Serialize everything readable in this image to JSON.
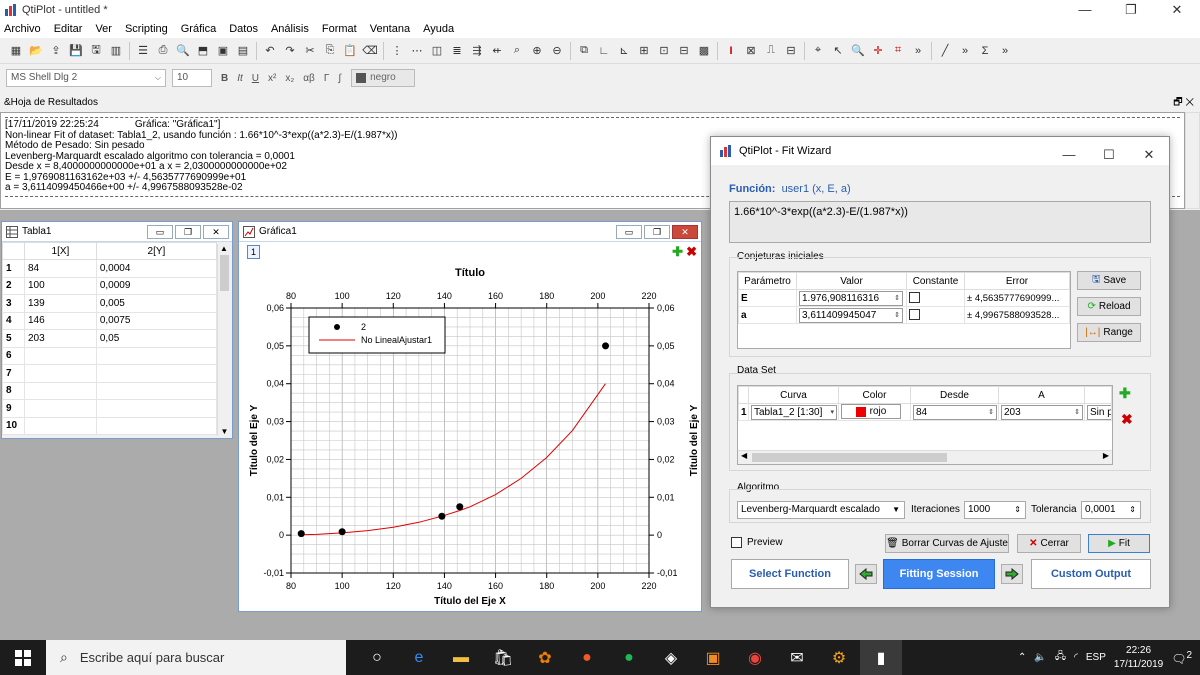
{
  "app": {
    "title": "QtiPlot - untitled *"
  },
  "menu": [
    "Archivo",
    "Editar",
    "Ver",
    "Scripting",
    "Gráfica",
    "Datos",
    "Análisis",
    "Format",
    "Ventana",
    "Ayuda"
  ],
  "format_bar": {
    "font": "MS Shell Dlg 2",
    "size": "10",
    "color": "negro"
  },
  "results": {
    "title": "&Hoja de Resultados",
    "lines": [
      "[17/11/2019 22:25:24             Gráfica: \"Gráfica1\"]",
      "Non-linear Fit of dataset: Tabla1_2, usando función : 1.66*10^-3*exp((a*2.3)-E/(1.987*x))",
      "Método de Pesado: Sin pesado",
      "Levenberg-Marquardt escalado algoritmo con tolerancia = 0,0001",
      "Desde x = 8,4000000000000e+01 a x = 2,0300000000000e+02",
      "E = 1,9769081163162e+03 +/- 4,5635777690999e+01",
      "a = 3,6114099450466e+00 +/- 4,9967588093528e-02"
    ]
  },
  "tabla": {
    "title": "Tabla1",
    "headers": [
      "1[X]",
      "2[Y]"
    ],
    "rows": [
      [
        "1",
        "84",
        "0,0004"
      ],
      [
        "2",
        "100",
        "0,0009"
      ],
      [
        "3",
        "139",
        "0,005"
      ],
      [
        "4",
        "146",
        "0,0075"
      ],
      [
        "5",
        "203",
        "0,05"
      ],
      [
        "6",
        "",
        ""
      ],
      [
        "7",
        "",
        ""
      ],
      [
        "8",
        "",
        ""
      ],
      [
        "9",
        "",
        ""
      ],
      [
        "10",
        "",
        ""
      ]
    ]
  },
  "grafica": {
    "title": "Gráfica1",
    "layer": "1"
  },
  "chart_data": {
    "type": "scatter",
    "title": "Título",
    "xlabel": "Título del Eje X",
    "ylabel": "Título del Eje Y",
    "ylabel_right": "Título del Eje Y",
    "xlim": [
      80,
      220
    ],
    "ylim": [
      -0.01,
      0.06
    ],
    "xticks": [
      80,
      100,
      120,
      140,
      160,
      180,
      200,
      220
    ],
    "yticks": [
      -0.01,
      0,
      0.01,
      0.02,
      0.03,
      0.04,
      0.05,
      0.06
    ],
    "ytick_labels": [
      "-0,01",
      "0",
      "0,01",
      "0,02",
      "0,03",
      "0,04",
      "0,05",
      "0,06"
    ],
    "grid": true,
    "legend_position": "top-left",
    "series": [
      {
        "name": "2",
        "kind": "points",
        "color": "#000000",
        "x": [
          84,
          100,
          139,
          146,
          203
        ],
        "y": [
          0.0004,
          0.0009,
          0.005,
          0.0075,
          0.05
        ]
      },
      {
        "name": "No LinealAjustar1",
        "kind": "curve",
        "color": "#e00000",
        "x": [
          84,
          90,
          100,
          110,
          120,
          130,
          139,
          146,
          150,
          160,
          170,
          180,
          190,
          203
        ],
        "y": [
          0.0001,
          0.0002,
          0.0006,
          0.0012,
          0.0021,
          0.0034,
          0.005,
          0.0065,
          0.0075,
          0.0107,
          0.015,
          0.0205,
          0.0276,
          0.04
        ]
      }
    ]
  },
  "fit": {
    "title": "QtiPlot - Fit Wizard",
    "function_label": "Función:",
    "function_name": "user1 (x, E, a)",
    "function_expr": "1.66*10^-3*exp((a*2.3)-E/(1.987*x))",
    "initial_label": "Conjeturas iniciales",
    "param_headers": [
      "Parámetro",
      "Valor",
      "Constante",
      "Error"
    ],
    "params": [
      {
        "name": "E",
        "value": "1.976,908116316",
        "error": "± 4,5635777690999..."
      },
      {
        "name": "a",
        "value": "3,611409945047",
        "error": "± 4,9967588093528..."
      }
    ],
    "save": "Save",
    "reload": "Reload",
    "range": "Range",
    "dataset_label": "Data Set",
    "ds_headers": [
      "Curva",
      "Color",
      "Desde",
      "A"
    ],
    "dataset": {
      "row": "1",
      "curve": "Tabla1_2 [1:30]",
      "color": "rojo",
      "from": "84",
      "to": "203",
      "weight": "Sin pe"
    },
    "algorithm_label": "Algoritmo",
    "algorithm": "Levenberg-Marquardt escalado",
    "iter_label": "Iteraciones",
    "iterations": "1000",
    "tol_label": "Tolerancia",
    "tolerance": "0,0001",
    "preview": "Preview",
    "clear": "Borrar Curvas de Ajuste",
    "close": "Cerrar",
    "fitbtn": "Fit",
    "select_function": "Select Function",
    "fitting_session": "Fitting Session",
    "custom_output": "Custom Output"
  },
  "taskbar": {
    "search": "Escribe aquí para buscar",
    "lang": "ESP",
    "time": "22:26",
    "date": "17/11/2019",
    "notif": "2"
  }
}
